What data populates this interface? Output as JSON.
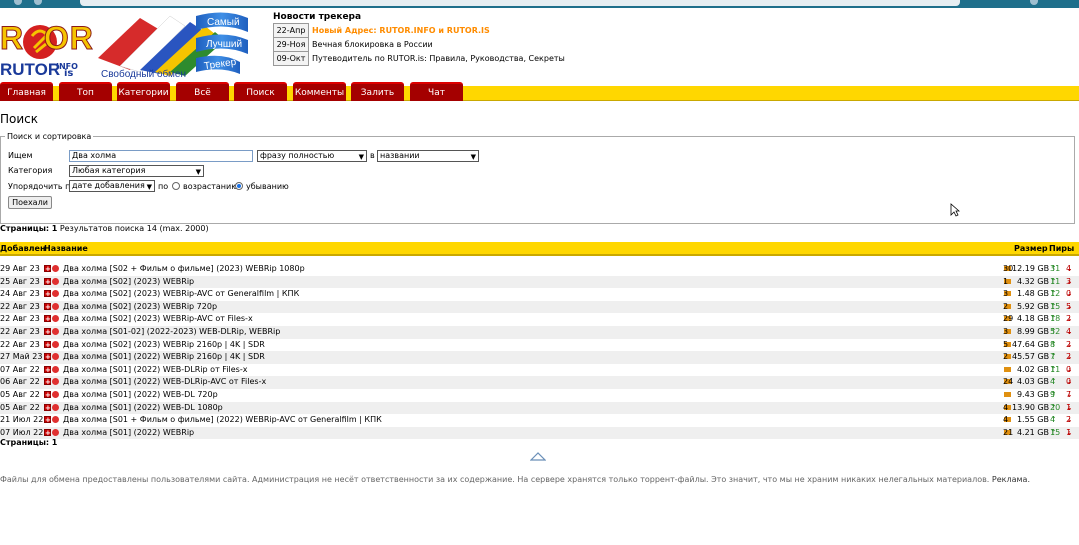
{
  "logo": {
    "text_main": "R  OR",
    "text_rutor": "RUTOR",
    "text_info": "INFO",
    "text_is": "is",
    "slogan": "Свободный обмен",
    "flag_words": [
      "Самый",
      "Лучший",
      "Трекер"
    ]
  },
  "news": {
    "header": "Новости трекера",
    "items": [
      {
        "date": "22-Апр",
        "text": "Новый Адрес: RUTOR.INFO и RUTOR.IS",
        "highlight": true
      },
      {
        "date": "29-Ноя",
        "text": "Вечная блокировка в России",
        "highlight": false
      },
      {
        "date": "09-Окт",
        "text": "Путеводитель по RUTOR.is: Правила, Руководства, Секреты",
        "highlight": false
      }
    ]
  },
  "menu": [
    "Главная",
    "Топ",
    "Категории",
    "Всё",
    "Поиск",
    "Комменты",
    "Залить",
    "Чат"
  ],
  "page_title": "Поиск",
  "search": {
    "legend": "Поиск и сортировка",
    "query_label": "Ищем",
    "query_value": "Два холма",
    "match_mode": "фразу полностью",
    "in_label": "в",
    "search_in": "названии",
    "category_label": "Категория",
    "category_value": "Любая категория",
    "sort_label": "Упорядочить по",
    "sort_value": "дате добавления",
    "by_label": "по",
    "asc_label": "возрастанию",
    "desc_label": "убыванию",
    "selected_order": "desc",
    "submit_label": "Поехали"
  },
  "pages_label": "Страницы:",
  "pages_value": "1",
  "results_summary": "Результатов поиска 14 (max. 2000)",
  "table": {
    "headers": {
      "added": "Добавлен",
      "name": "Название",
      "size": "Размер",
      "peers": "Пиры"
    },
    "rows": [
      {
        "date": "29 Авг 23",
        "title": "Два холма [S02 + Фильм о фильме] (2023) WEBRip 1080p",
        "comments": "30",
        "size": "12.19 GB",
        "seeds": "31",
        "leech": "4"
      },
      {
        "date": "25 Авг 23",
        "title": "Два холма [S02] (2023) WEBRip",
        "comments": "1",
        "size": "4.32 GB",
        "seeds": "11",
        "leech": "3"
      },
      {
        "date": "24 Авг 23",
        "title": "Два холма [S02] (2023) WEBRip-AVC от Generalfilm | КПК",
        "comments": "3",
        "size": "1.48 GB",
        "seeds": "12",
        "leech": "0"
      },
      {
        "date": "22 Авг 23",
        "title": "Два холма [S02] (2023) WEBRip 720p",
        "comments": "2",
        "size": "5.92 GB",
        "seeds": "15",
        "leech": "5"
      },
      {
        "date": "22 Авг 23",
        "title": "Два холма [S02] (2023) WEBRip-AVC от Files-x",
        "comments": "29",
        "size": "4.18 GB",
        "seeds": "18",
        "leech": "2"
      },
      {
        "date": "22 Авг 23",
        "title": "Два холма [S01-02] (2022-2023) WEB-DLRip, WEBRip",
        "comments": "3",
        "size": "8.99 GB",
        "seeds": "52",
        "leech": "4"
      },
      {
        "date": "22 Авг 23",
        "title": "Два холма [S02] (2023) WEBRip 2160p | 4K | SDR",
        "comments": "5",
        "size": "47.64 GB",
        "seeds": "8",
        "leech": "2"
      },
      {
        "date": "27 Май 23",
        "title": "Два холма [S01] (2022) WEBRip 2160p | 4K | SDR",
        "comments": "2",
        "size": "45.57 GB",
        "seeds": "7",
        "leech": "2"
      },
      {
        "date": "07 Авг 22",
        "title": "Два холма [S01] (2022) WEB-DLRip от Files-x",
        "comments": "",
        "size": "4.02 GB",
        "seeds": "11",
        "leech": "0"
      },
      {
        "date": "06 Авг 22",
        "title": "Два холма [S01] (2022) WEB-DLRip-AVC от Files-x",
        "comments": "24",
        "size": "4.03 GB",
        "seeds": "4",
        "leech": "0"
      },
      {
        "date": "05 Авг 22",
        "title": "Два холма [S01] (2022) WEB-DL 720p",
        "comments": "",
        "size": "9.43 GB",
        "seeds": "9",
        "leech": "7"
      },
      {
        "date": "05 Авг 22",
        "title": "Два холма [S01] (2022) WEB-DL 1080p",
        "comments": "4",
        "size": "13.90 GB",
        "seeds": "20",
        "leech": "1"
      },
      {
        "date": "21 Июл 22",
        "title": "Два холма [S01 + Фильм о фильме] (2022) WEBRip-AVC от Generalfilm | КПК",
        "comments": "4",
        "size": "1.55 GB",
        "seeds": "4",
        "leech": "2"
      },
      {
        "date": "07 Июл 22",
        "title": "Два холма [S01] (2022) WEBRip",
        "comments": "21",
        "size": "4.21 GB",
        "seeds": "15",
        "leech": "1"
      }
    ]
  },
  "footer_text": "Файлы для обмена предоставлены пользователями сайта. Администрация не несёт ответственности за их содержание. На сервере хранятся только торрент-файлы. Это значит, что мы не храним никаких нелегальных материалов.",
  "footer_link": "Реклама.",
  "colors": {
    "accent_yellow": "#ffd700",
    "menu_red": "#a40000",
    "news_highlight": "#ff8c00",
    "seed_green": "#2a8a2a",
    "leech_red": "#b00000"
  },
  "icons": [
    "download-icon",
    "magnet-icon",
    "comment-icon",
    "up-arrow-icon",
    "down-arrow-icon",
    "scroll-up-icon"
  ]
}
